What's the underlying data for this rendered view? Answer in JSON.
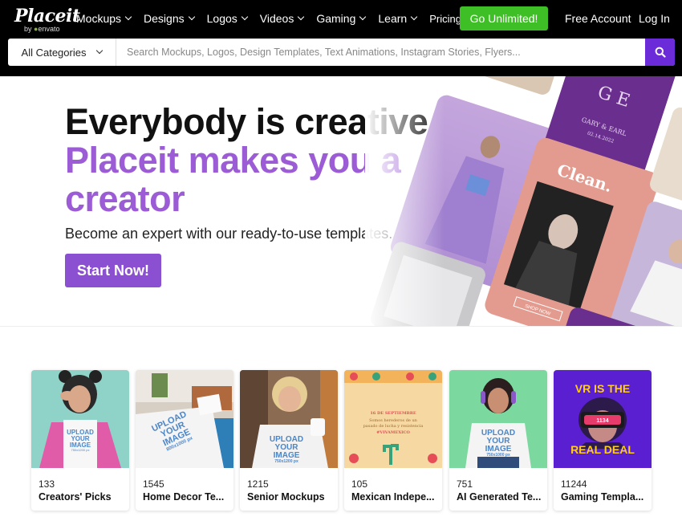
{
  "header": {
    "logo": {
      "brand": "Placeit",
      "by": "by",
      "envato": "envato"
    },
    "nav": [
      {
        "label": "Mockups",
        "dropdown": true
      },
      {
        "label": "Designs",
        "dropdown": true
      },
      {
        "label": "Logos",
        "dropdown": true
      },
      {
        "label": "Videos",
        "dropdown": true
      },
      {
        "label": "Gaming",
        "dropdown": true
      },
      {
        "label": "Learn",
        "dropdown": true
      },
      {
        "label": "Pricing",
        "dropdown": false
      }
    ],
    "cta": "Go Unlimited!",
    "free_account": "Free Account",
    "login": "Log In"
  },
  "search": {
    "category": "All Categories",
    "placeholder": "Search Mockups, Logos, Design Templates, Text Animations, Instagram Stories, Flyers...",
    "button_icon": "search-icon"
  },
  "hero": {
    "line1": "Everybody is creative,",
    "line2": "Placeit makes you a",
    "line3": "creator",
    "subtitle": "Become an expert with our ready-to-use templates.",
    "button": "Start Now!",
    "collage": {
      "clean_label": "Clean.",
      "shop_label": "SHOP NOW",
      "monogram": "G E",
      "names": "GARY & EARL",
      "date": "02.14.2022"
    }
  },
  "categories": [
    {
      "count": "133",
      "name": "Creators' Picks",
      "tee": [
        "UPLOAD",
        "YOUR",
        "IMAGE",
        "750x1200 px"
      ]
    },
    {
      "count": "1545",
      "name": "Home Decor Te...",
      "tee": [
        "UPLOAD",
        "YOUR",
        "IMAGE",
        "800x1000 px"
      ]
    },
    {
      "count": "1215",
      "name": "Senior Mockups",
      "tee": [
        "UPLOAD",
        "YOUR",
        "IMAGE",
        "750x1200 px"
      ]
    },
    {
      "count": "105",
      "name": "Mexican Indepe...",
      "tee": [
        "16 DE SEPTIEMBRE",
        "Somos herederos de un",
        "pasado de lucha y resistencia",
        "#VIVAMEXICO"
      ]
    },
    {
      "count": "751",
      "name": "AI Generated Te...",
      "tee": [
        "UPLOAD",
        "YOUR",
        "IMAGE",
        "750x1000 px"
      ]
    },
    {
      "count": "11244",
      "name": "Gaming Templa...",
      "tee": [
        "VR IS THE",
        "REAL DEAL",
        "1134"
      ]
    }
  ],
  "colors": {
    "header_bg": "#000000",
    "cta_green": "#3fbf26",
    "brand_purple": "#6c2bd9",
    "hero_purple": "#9b5cd6",
    "start_button": "#8b4fd1"
  }
}
